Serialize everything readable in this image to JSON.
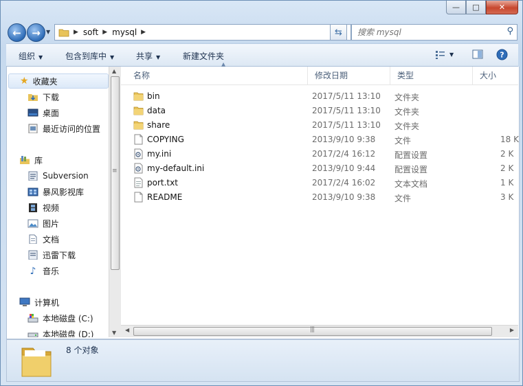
{
  "window": {
    "caption": {
      "minimize": "—",
      "maximize": "□",
      "close": "✕"
    }
  },
  "address": {
    "segments": [
      "soft",
      "mysql"
    ],
    "search_placeholder": "搜索 mysql"
  },
  "toolbar": {
    "organize": "组织",
    "include_in_library": "包含到库中",
    "share": "共享",
    "new_folder": "新建文件夹"
  },
  "navpane": {
    "favorites": "收藏夹",
    "downloads": "下载",
    "desktop": "桌面",
    "recent": "最近访问的位置",
    "libraries": "库",
    "subversion": "Subversion",
    "baofeng": "暴风影视库",
    "videos": "视频",
    "pictures": "图片",
    "documents": "文档",
    "xunlei": "迅雷下载",
    "music": "音乐",
    "computer": "计算机",
    "disk_c": "本地磁盘 (C:)",
    "disk_d": "本地磁盘 (D:)"
  },
  "columns": {
    "name": "名称",
    "date": "修改日期",
    "type": "类型",
    "size": "大小"
  },
  "files": [
    {
      "name": "bin",
      "date": "2017/5/11 13:10",
      "type": "文件夹",
      "size": "",
      "icon": "folder-icon"
    },
    {
      "name": "data",
      "date": "2017/5/11 13:10",
      "type": "文件夹",
      "size": "",
      "icon": "folder-icon"
    },
    {
      "name": "share",
      "date": "2017/5/11 13:10",
      "type": "文件夹",
      "size": "",
      "icon": "folder-icon"
    },
    {
      "name": "COPYING",
      "date": "2013/9/10 9:38",
      "type": "文件",
      "size": "18 K",
      "icon": "file-icon"
    },
    {
      "name": "my.ini",
      "date": "2017/2/4 16:12",
      "type": "配置设置",
      "size": "2 K",
      "icon": "config-file-icon"
    },
    {
      "name": "my-default.ini",
      "date": "2013/9/10 9:44",
      "type": "配置设置",
      "size": "2 K",
      "icon": "config-file-icon"
    },
    {
      "name": "port.txt",
      "date": "2017/2/4 16:02",
      "type": "文本文档",
      "size": "1 K",
      "icon": "text-file-icon"
    },
    {
      "name": "README",
      "date": "2013/9/10 9:38",
      "type": "文件",
      "size": "3 K",
      "icon": "file-icon"
    }
  ],
  "status": {
    "count": "8 个对象"
  },
  "colors": {
    "folder": "#e8c35a",
    "accent": "#2f6db8",
    "close": "#c7472e"
  }
}
